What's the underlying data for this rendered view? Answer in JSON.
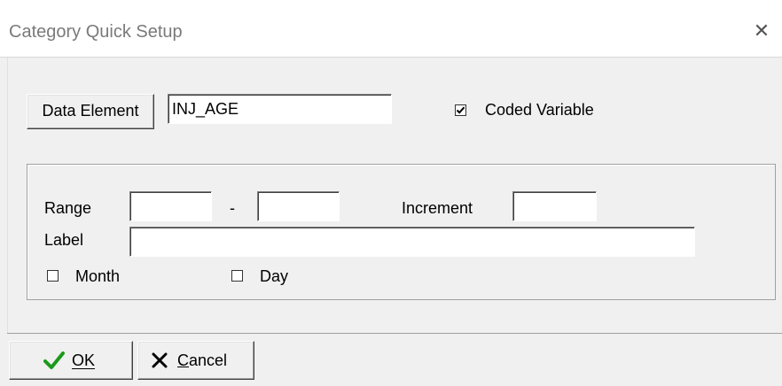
{
  "window": {
    "title": "Category Quick Setup",
    "close_glyph": "✕"
  },
  "data_element": {
    "button_label": "Data Element",
    "value": "INJ_AGE"
  },
  "coded_variable": {
    "label": "Coded Variable",
    "checked": true
  },
  "range": {
    "label": "Range",
    "separator": "-",
    "from_value": "",
    "to_value": ""
  },
  "increment": {
    "label": "Increment",
    "value": ""
  },
  "label_field": {
    "label": "Label",
    "value": ""
  },
  "month": {
    "label": "Month",
    "checked": false
  },
  "day": {
    "label": "Day",
    "checked": false
  },
  "ok_button": {
    "label": "OK",
    "icon": "checkmark-icon",
    "color": "#1a9a1a"
  },
  "cancel_button": {
    "label": "Cancel",
    "icon": "x-icon"
  }
}
